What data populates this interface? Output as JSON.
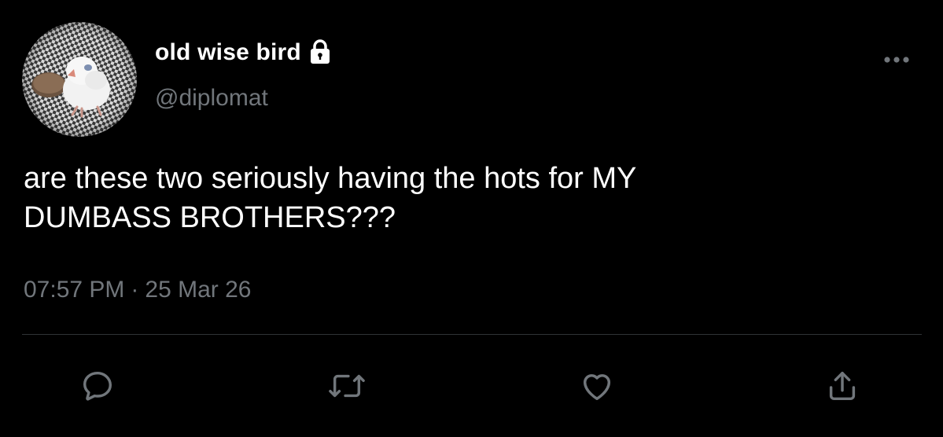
{
  "user": {
    "display_name": "old wise bird",
    "handle": "@diplomat",
    "protected_icon": "lock-icon",
    "avatar_icon": "avatar-owl-chick"
  },
  "tweet": {
    "text": "are these two seriously having the hots for MY\nDUMBASS BROTHERS???",
    "time": "07:57 PM",
    "separator": "·",
    "date": "25 Mar 26"
  },
  "actions": [
    {
      "name": "reply",
      "icon": "reply-bubble-icon"
    },
    {
      "name": "retweet",
      "icon": "retweet-icon"
    },
    {
      "name": "like",
      "icon": "heart-icon"
    },
    {
      "name": "share",
      "icon": "share-icon"
    }
  ],
  "menu": {
    "icon": "more-options-icon"
  },
  "colors": {
    "background": "#000000",
    "primary_text": "#ffffff",
    "secondary_text": "#71767b",
    "divider": "#2f3336",
    "icon": "#71767b"
  }
}
